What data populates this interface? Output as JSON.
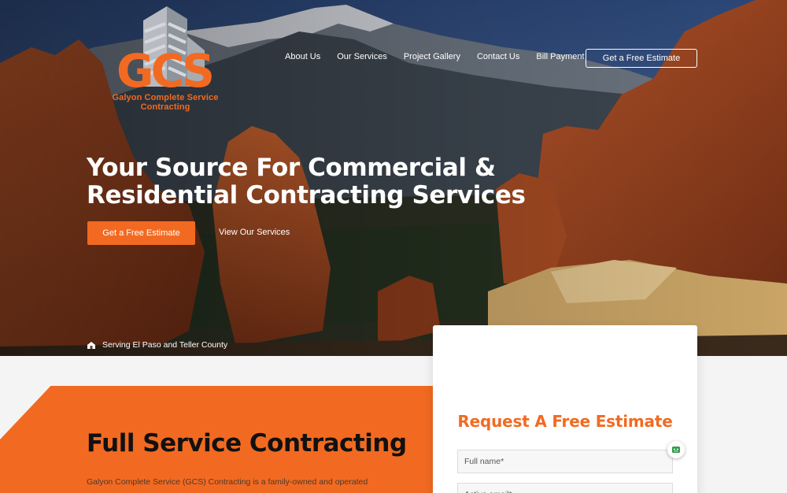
{
  "brand": {
    "logo_letters": "GCS",
    "name": "Galyon Complete Service Contracting",
    "accent_color": "#f26a21"
  },
  "nav": {
    "items": [
      {
        "label": "About Us"
      },
      {
        "label": "Our Services"
      },
      {
        "label": "Project Gallery"
      },
      {
        "label": "Contact Us"
      },
      {
        "label": "Bill Payment"
      }
    ],
    "cta_label": "Get a Free Estimate"
  },
  "hero": {
    "headline": "Your Source For Commercial & Residential Contracting Services",
    "primary_button": "Get a Free Estimate",
    "secondary_link": "View Our Services",
    "service_area_icon": "home-icon",
    "service_area": "Serving El Paso and Teller County"
  },
  "intro": {
    "title": "Full Service Contracting",
    "text": "Galyon Complete Service (GCS) Contracting is a family-owned and operated"
  },
  "estimate_form": {
    "title": "Request A Free Estimate",
    "full_name_placeholder": "Full name*",
    "email_placeholder": "Active email*"
  },
  "chat": {
    "icon": "chat-bot-icon"
  }
}
